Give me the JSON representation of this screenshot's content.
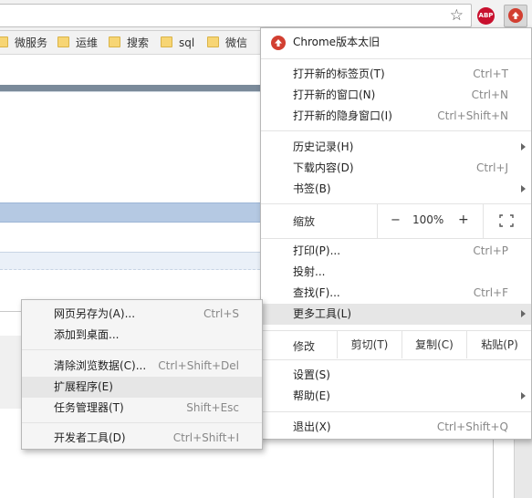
{
  "toolbar": {
    "star_glyph": "☆",
    "abp_label": "ABP"
  },
  "bookmarks": [
    {
      "label": "微服务"
    },
    {
      "label": "运维"
    },
    {
      "label": "搜索"
    },
    {
      "label": "sql"
    },
    {
      "label": "微信"
    }
  ],
  "chrome_menu": {
    "header": "Chrome版本太旧",
    "new_tab": {
      "label": "打开新的标签页(T)",
      "shortcut": "Ctrl+T"
    },
    "new_window": {
      "label": "打开新的窗口(N)",
      "shortcut": "Ctrl+N"
    },
    "incognito": {
      "label": "打开新的隐身窗口(I)",
      "shortcut": "Ctrl+Shift+N"
    },
    "history": {
      "label": "历史记录(H)"
    },
    "downloads": {
      "label": "下载内容(D)",
      "shortcut": "Ctrl+J"
    },
    "bookmarks": {
      "label": "书签(B)"
    },
    "zoom": {
      "label": "缩放",
      "minus": "−",
      "value": "100%",
      "plus": "+"
    },
    "print": {
      "label": "打印(P)...",
      "shortcut": "Ctrl+P"
    },
    "cast": {
      "label": "投射..."
    },
    "find": {
      "label": "查找(F)...",
      "shortcut": "Ctrl+F"
    },
    "more_tools": {
      "label": "更多工具(L)"
    },
    "edit": {
      "label": "修改",
      "cut": "剪切(T)",
      "copy": "复制(C)",
      "paste": "粘贴(P)"
    },
    "settings": {
      "label": "设置(S)"
    },
    "help": {
      "label": "帮助(E)"
    },
    "exit": {
      "label": "退出(X)",
      "shortcut": "Ctrl+Shift+Q"
    }
  },
  "more_tools_menu": {
    "save_as": {
      "label": "网页另存为(A)...",
      "shortcut": "Ctrl+S"
    },
    "add_to_desktop": {
      "label": "添加到桌面..."
    },
    "clear_data": {
      "label": "清除浏览数据(C)...",
      "shortcut": "Ctrl+Shift+Del"
    },
    "extensions": {
      "label": "扩展程序(E)"
    },
    "task_manager": {
      "label": "任务管理器(T)",
      "shortcut": "Shift+Esc"
    },
    "dev_tools": {
      "label": "开发者工具(D)",
      "shortcut": "Ctrl+Shift+I"
    }
  }
}
